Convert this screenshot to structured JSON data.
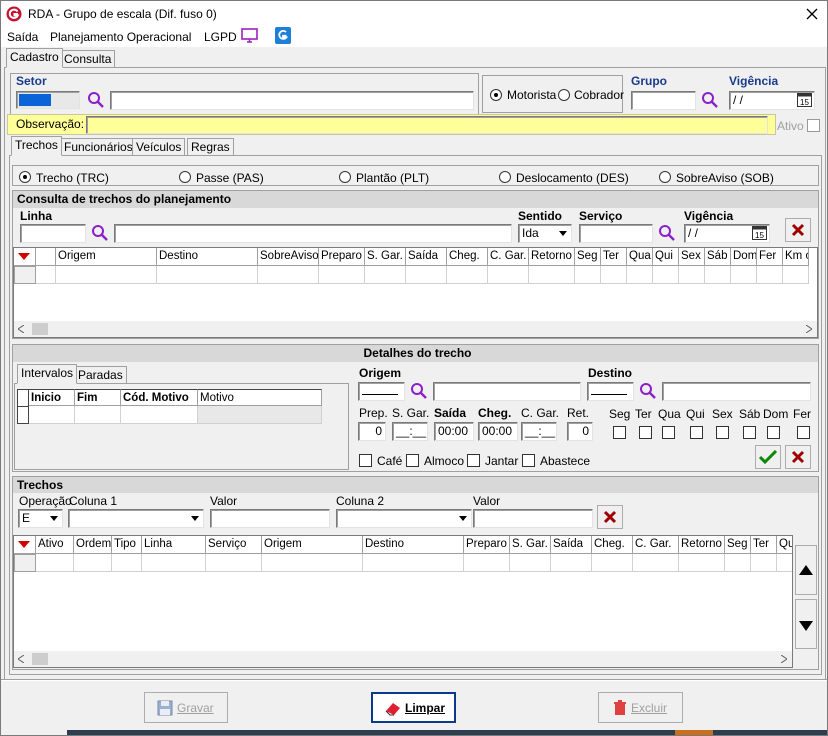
{
  "title": "RDA - Grupo de escala (Dif. fuso 0)",
  "menu": {
    "saida": "Saída",
    "planejamento": "Planejamento Operacional",
    "lgpd": "LGPD"
  },
  "main_tabs": {
    "cadastro": "Cadastro",
    "consulta": "Consulta"
  },
  "top": {
    "setor_label": "Setor",
    "motorista": "Motorista",
    "cobrador": "Cobrador",
    "grupo_label": "Grupo",
    "vigencia_label": "Vigência",
    "vigencia_value": " / /",
    "observacao_label": "Observação:",
    "ativo_label": "Ativo"
  },
  "sub_tabs": {
    "trechos": "Trechos",
    "funcionarios": "Funcionários",
    "veiculos": "Veículos",
    "regras": "Regras"
  },
  "types": [
    "Trecho (TRC)",
    "Passe (PAS)",
    "Plantão (PLT)",
    "Deslocamento (DES)",
    "SobreAviso (SOB)"
  ],
  "consulta": {
    "header": "Consulta de trechos do planejamento",
    "linha_label": "Linha",
    "sentido_label": "Sentido",
    "sentido_value": "Ida",
    "servico_label": "Serviço",
    "vigencia_label": "Vigência",
    "vigencia_value": " / /",
    "columns": [
      "Origem",
      "Destino",
      "SobreAviso",
      "Preparo",
      "S. Gar.",
      "Saída",
      "Cheg.",
      "C. Gar.",
      "Retorno",
      "Seg",
      "Ter",
      "Qua",
      "Qui",
      "Sex",
      "Sáb",
      "Dom",
      "Fer",
      "Km oc"
    ]
  },
  "detalhes": {
    "header": "Detalhes do trecho",
    "tab_intervalos": "Intervalos",
    "tab_paradas": "Paradas",
    "int_columns": [
      "Inicio",
      "Fim",
      "Cód. Motivo",
      "Motivo"
    ],
    "origem_label": "Origem",
    "destino_label": "Destino",
    "field_labels": [
      "Prep.",
      "S. Gar.",
      "Saída",
      "Cheg.",
      "C. Gar.",
      "Ret."
    ],
    "field_values": [
      "0",
      "__:__",
      "00:00",
      "00:00",
      "__:__",
      "0"
    ],
    "days": [
      "Seg",
      "Ter",
      "Qua",
      "Qui",
      "Sex",
      "Sáb",
      "Dom",
      "Fer"
    ],
    "meals": [
      "Café",
      "Almoco",
      "Jantar",
      "Abastece"
    ]
  },
  "trechos": {
    "header": "Trechos",
    "operacao_label": "Operação",
    "operacao_value": "E",
    "coluna1_label": "Coluna 1",
    "valor1_label": "Valor",
    "coluna2_label": "Coluna 2",
    "valor2_label": "Valor",
    "columns": [
      "Ativo",
      "Ordem",
      "Tipo",
      "Linha",
      "Serviço",
      "Origem",
      "Destino",
      "Preparo",
      "S. Gar.",
      "Saída",
      "Cheg.",
      "C. Gar.",
      "Retorno",
      "Seg",
      "Ter",
      "Qua"
    ]
  },
  "buttons": {
    "gravar": "Gravar",
    "limpar": "Limpar",
    "excluir": "Excluir"
  },
  "colors": {
    "accent": "#1a3a8a",
    "magnifier": "#8b1fc9",
    "observation_bg": "#ffff99",
    "close_red": "#a00000",
    "ok_green": "#0a8a0a"
  }
}
